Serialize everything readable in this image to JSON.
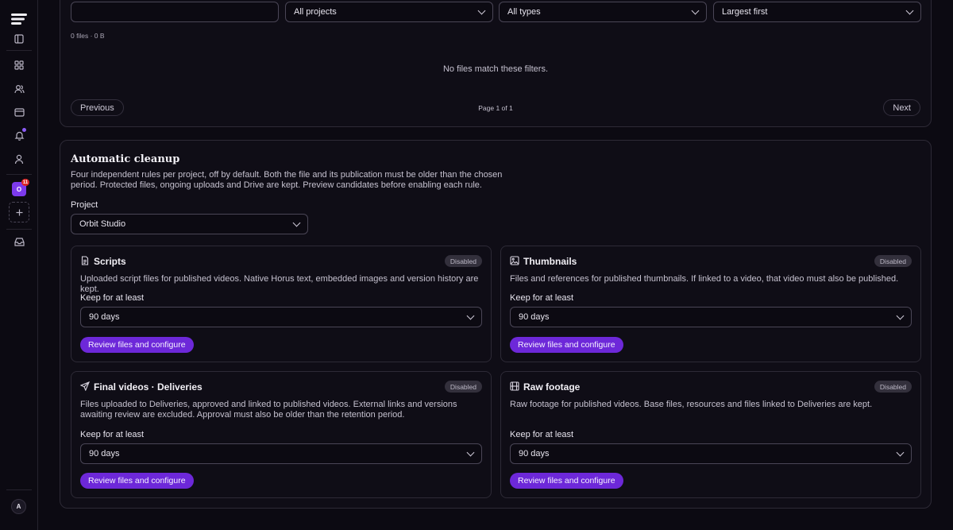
{
  "sidebar": {
    "items": [
      "logo-icon",
      "panel-toggle-icon",
      "dashboard-icon",
      "users-icon",
      "billing-icon",
      "bell-icon",
      "profile-icon",
      "workspace",
      "add-workspace-icon",
      "inbox-icon",
      "account"
    ],
    "workspace_initial": "O",
    "workspace_badge": "11",
    "account_initial": "A"
  },
  "filters": {
    "search_value": "",
    "project_value": "All projects",
    "type_value": "All types",
    "sort_value": "Largest first",
    "summary": "0 files · 0 B",
    "empty_message": "No files match these filters.",
    "previous_label": "Previous",
    "page_label": "Page 1 of 1",
    "next_label": "Next"
  },
  "cleanup": {
    "title": "Automatic cleanup",
    "description_line1": "Four independent rules per project, off by default. Both the file and its publication must be older than the chosen",
    "description_line2": "period. Protected files, ongoing uploads and Drive are kept. Preview candidates before enabling each rule.",
    "project_label": "Project",
    "project_value": "Orbit Studio",
    "rules": [
      {
        "icon": "file-text-icon",
        "title": "Scripts",
        "status": "Disabled",
        "description": "Uploaded script files for published videos. Native Horus text, embedded images and version history are kept.",
        "keep_label": "Keep for at least",
        "keep_value": "90 days",
        "action_label": "Review files and configure"
      },
      {
        "icon": "image-icon",
        "title": "Thumbnails",
        "status": "Disabled",
        "description": "Files and references for published thumbnails. If linked to a video, that video must also be published.",
        "keep_label": "Keep for at least",
        "keep_value": "90 days",
        "action_label": "Review files and configure"
      },
      {
        "icon": "send-icon",
        "title": "Final videos · Deliveries",
        "status": "Disabled",
        "description": "Files uploaded to Deliveries, approved and linked to published videos. External links and versions awaiting review are excluded. Approval must also be older than the retention period.",
        "keep_label": "Keep for at least",
        "keep_value": "90 days",
        "action_label": "Review files and configure"
      },
      {
        "icon": "film-icon",
        "title": "Raw footage",
        "status": "Disabled",
        "description": "Raw footage for published videos. Base files, resources and files linked to Deliveries are kept.",
        "keep_label": "Keep for at least",
        "keep_value": "90 days",
        "action_label": "Review files and configure"
      }
    ]
  },
  "colors": {
    "accent": "#6d28d9",
    "background": "#0c0a12",
    "panel_border": "#2d2a36",
    "badge_bg": "#33303c",
    "notification_dot": "#8b5cf6",
    "workspace_badge_bg": "#dc2626"
  }
}
